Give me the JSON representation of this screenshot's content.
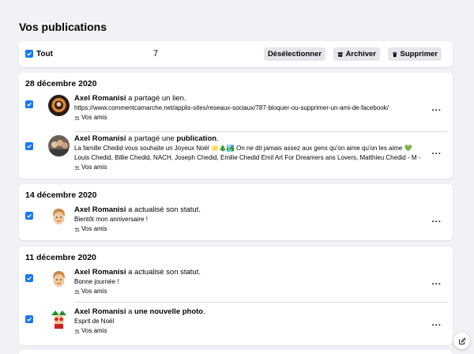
{
  "page_title": "Vos publications",
  "toolbar": {
    "select_all_label": "Tout",
    "selected_count": "7",
    "deselect_label": "Désélectionner",
    "archive_label": "Archiver",
    "delete_label": "Supprimer"
  },
  "sections": [
    {
      "date": "28 décembre 2020",
      "items": [
        {
          "author": "Axel Romanisi",
          "action_pre": " a partagé un lien.",
          "action_bold": "",
          "action_post": "",
          "sub1": "https://www.commentcamarche.net/applis-sites/reseaux-sociaux/787-bloquer-ou-supprimer-un-ami-de-facebook/",
          "sub2": "",
          "audience": "Vos amis",
          "more": "···"
        },
        {
          "author": "Axel Romanisi",
          "action_pre": " a partagé une ",
          "action_bold": "publication",
          "action_post": ".",
          "sub1": "La famille Chedid vous souhaite un Joyeux Noël 🌟🎄🏞️ On ne dit jamais assez aux gens qu'on aime qu'on les aime 💚",
          "sub2": "Louis Chedid, Billie Chedid, NACH, Joseph Chedid, Emilie Chedid Emil Art For Dreamers ans Lovers, Matthieu Chedid - M -",
          "audience": "Vos amis",
          "more": "···"
        }
      ]
    },
    {
      "date": "14 décembre 2020",
      "items": [
        {
          "author": "Axel Romanisi",
          "action_pre": " a actualisé son statut.",
          "action_bold": "",
          "action_post": "",
          "sub1": "Bientôt mon anniversaire !",
          "sub2": "",
          "audience": "Vos amis",
          "more": "···"
        }
      ]
    },
    {
      "date": "11 décembre 2020",
      "items": [
        {
          "author": "Axel Romanisi",
          "action_pre": " a actualisé son statut.",
          "action_bold": "",
          "action_post": "",
          "sub1": "Bonne journée !",
          "sub2": "",
          "audience": "Vos amis",
          "more": "···"
        },
        {
          "author": "Axel Romanisi",
          "action_pre": " a ",
          "action_bold": "une nouvelle photo",
          "action_post": ".",
          "sub1": "Esprit de Noël",
          "sub2": "",
          "audience": "Vos amis",
          "more": "···"
        }
      ]
    }
  ],
  "icons": {
    "checkbox": "check-icon",
    "archive": "archive-icon",
    "delete": "trash-icon",
    "audience": "friends-icon",
    "fab": "compose-icon"
  },
  "colors": {
    "accent": "#1877f2",
    "background": "#f0f2f5",
    "button_bg": "#e4e6eb"
  }
}
